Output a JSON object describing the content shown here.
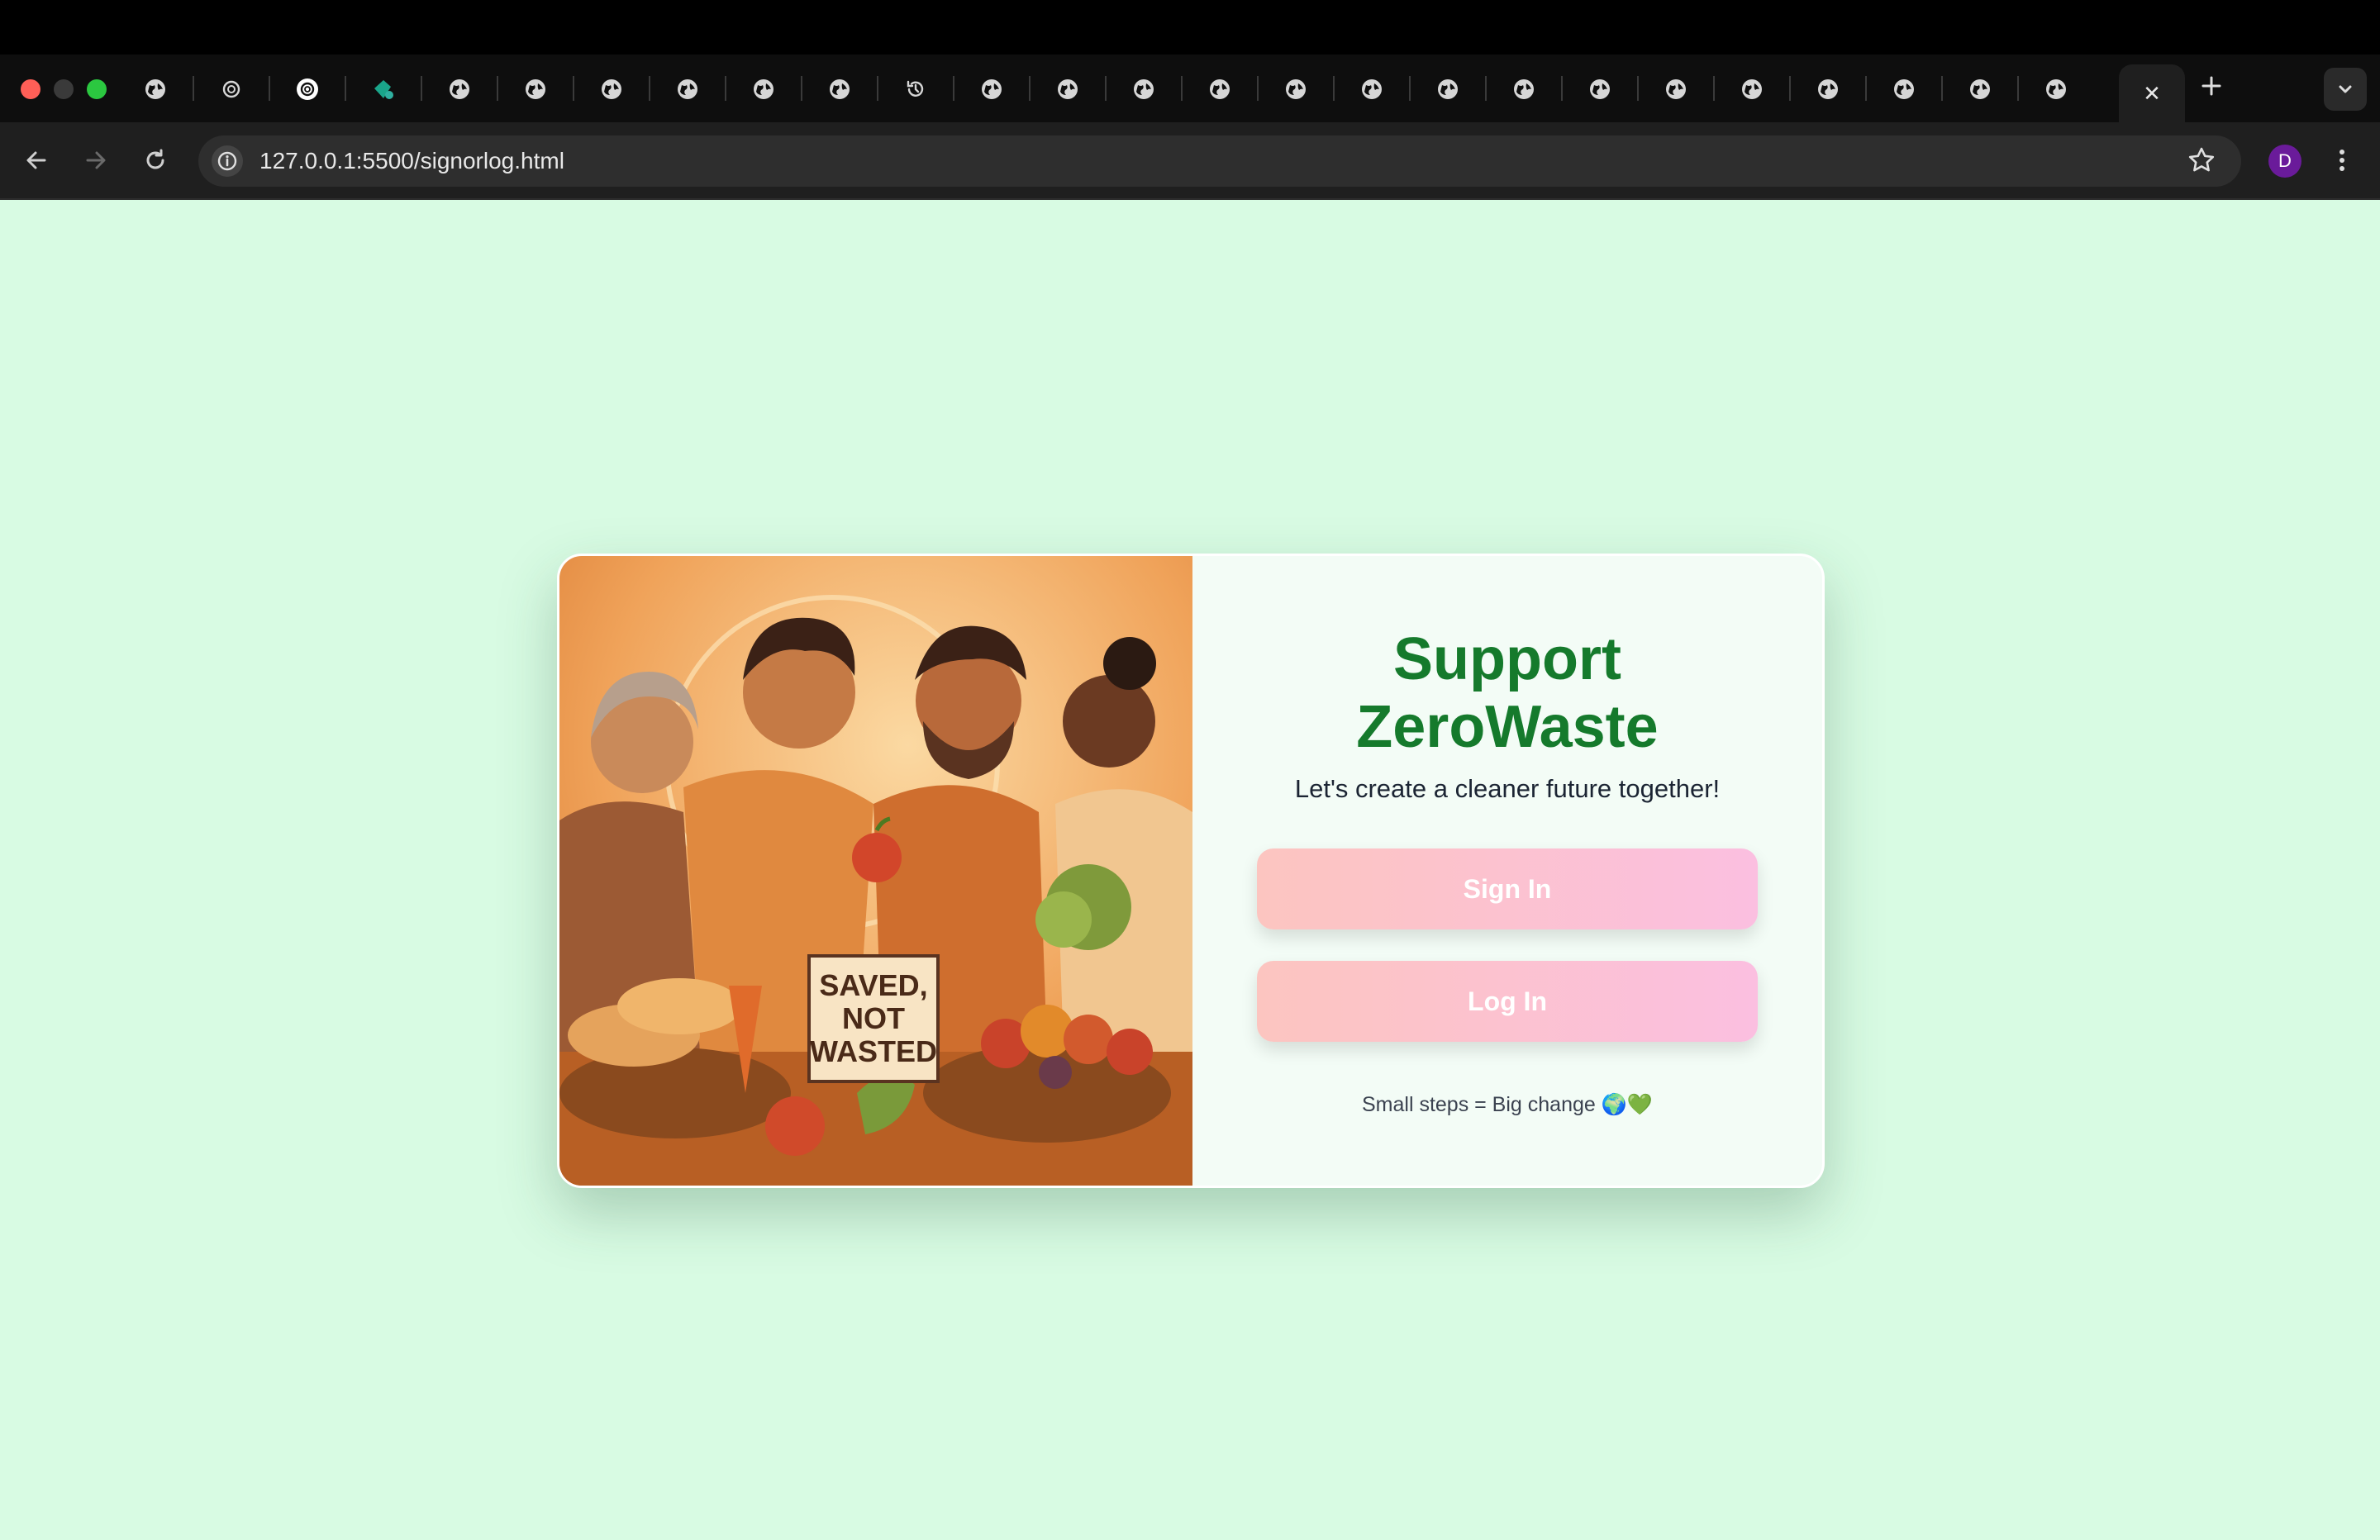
{
  "browser": {
    "url": "127.0.0.1:5500/signorlog.html",
    "profile_initial": "D",
    "active_tab_close": "✕",
    "new_tab": "+"
  },
  "page": {
    "title_line1": "Support",
    "title_line2": "ZeroWaste",
    "subtitle": "Let's create a cleaner future together!",
    "sign_in_label": "Sign In",
    "log_in_label": "Log In",
    "tagline": "Small steps = Big change 🌍💚",
    "illustration_sign": [
      "SAVED,",
      "NOT",
      "WASTED"
    ]
  },
  "colors": {
    "background": "#d8fbe3",
    "title": "#157a2c",
    "button_gradient_start": "#fcc5c0",
    "button_gradient_end": "#fbbfe0"
  }
}
